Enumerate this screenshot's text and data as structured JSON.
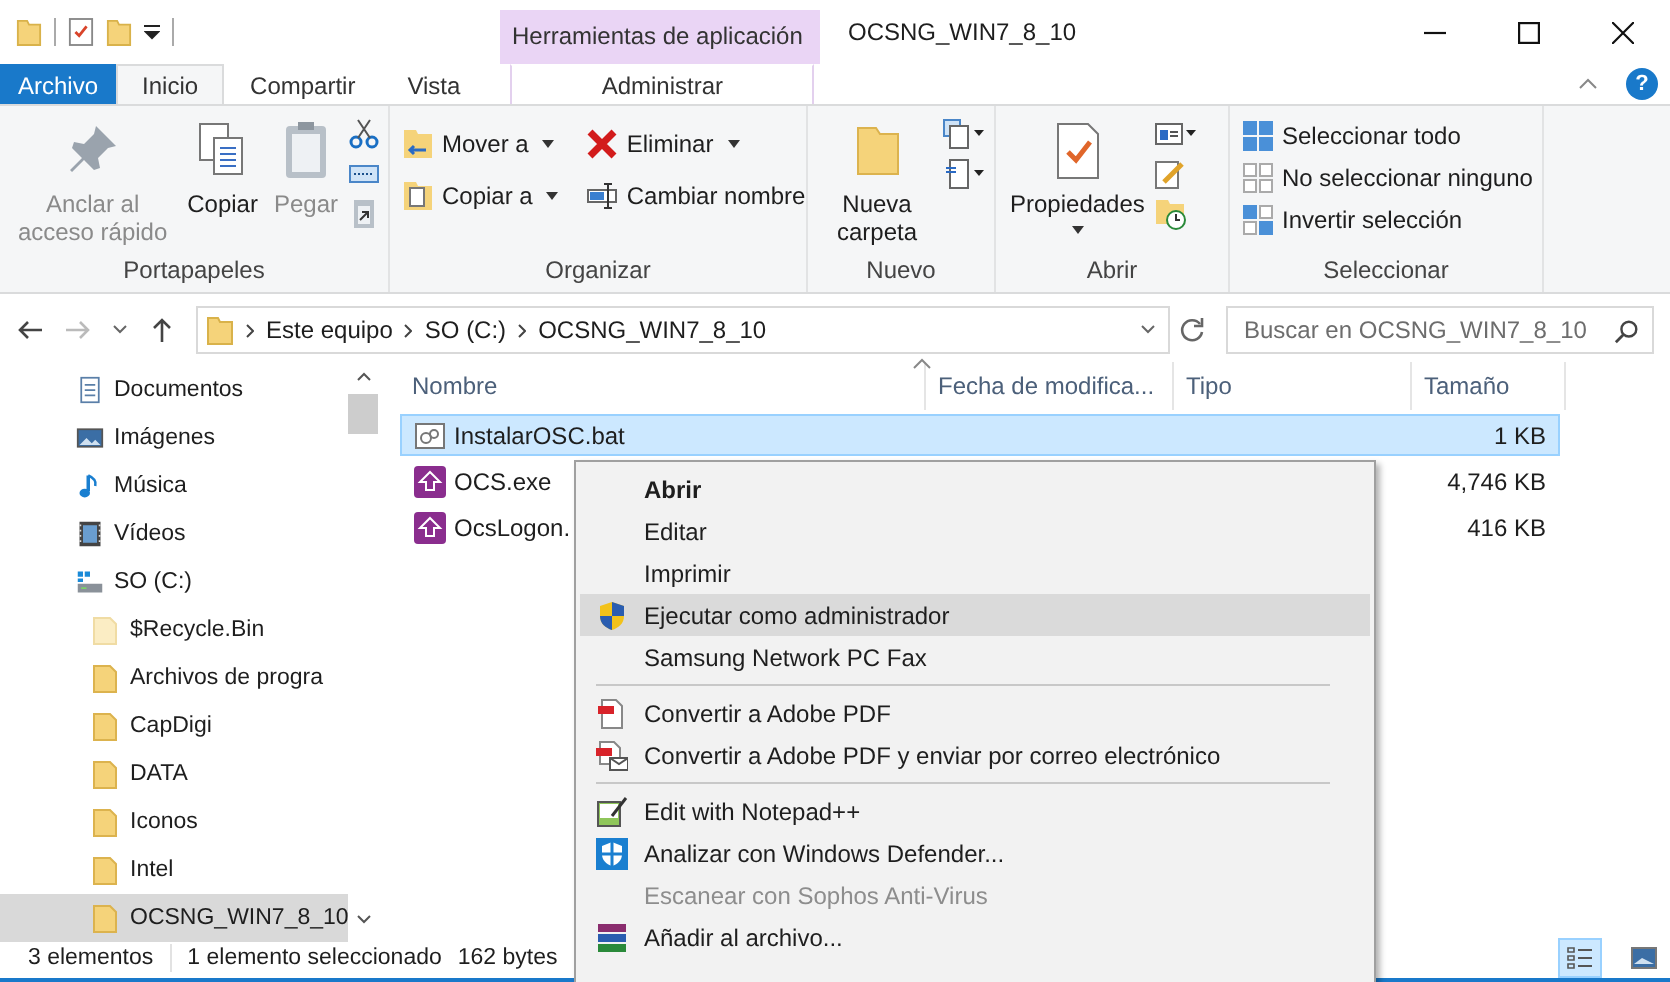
{
  "window": {
    "title": "OCSNG_WIN7_8_10",
    "context_header": "Herramientas de aplicación",
    "help_label": "?"
  },
  "tabs": [
    {
      "label": "Archivo",
      "kind": "file",
      "selected": false
    },
    {
      "label": "Inicio",
      "kind": "normal",
      "selected": true
    },
    {
      "label": "Compartir",
      "kind": "normal",
      "selected": false
    },
    {
      "label": "Vista",
      "kind": "normal",
      "selected": false
    },
    {
      "label": "Administrar",
      "kind": "context",
      "selected": false
    }
  ],
  "ribbon": {
    "clipboard": {
      "label": "Portapapeles",
      "pin": {
        "label": "Anclar al acceso rápido",
        "disabled": true
      },
      "copy": {
        "label": "Copiar",
        "disabled": false
      },
      "paste": {
        "label": "Pegar",
        "disabled": true
      }
    },
    "organize": {
      "label": "Organizar",
      "move": "Mover a",
      "copy_to": "Copiar a",
      "delete": "Eliminar",
      "rename": "Cambiar nombre"
    },
    "new": {
      "label": "Nuevo",
      "new_folder": "Nueva carpeta"
    },
    "open": {
      "label": "Abrir",
      "properties": "Propiedades"
    },
    "select": {
      "label": "Seleccionar",
      "items": [
        "Seleccionar todo",
        "No seleccionar ninguno",
        "Invertir selección"
      ]
    }
  },
  "address": {
    "breadcrumbs": [
      "Este equipo",
      "SO (C:)",
      "OCSNG_WIN7_8_10"
    ],
    "search_placeholder": "Buscar en OCSNG_WIN7_8_10"
  },
  "sidebar": {
    "items": [
      {
        "label": "Documentos",
        "selected": false
      },
      {
        "label": "Imágenes",
        "selected": false
      },
      {
        "label": "Música",
        "selected": false
      },
      {
        "label": "Vídeos",
        "selected": false
      },
      {
        "label": "SO (C:)",
        "selected": false,
        "children": [
          {
            "label": "$Recycle.Bin",
            "selected": false
          },
          {
            "label": "Archivos de progra",
            "selected": false
          },
          {
            "label": "CapDigi",
            "selected": false
          },
          {
            "label": "DATA",
            "selected": false
          },
          {
            "label": "Iconos",
            "selected": false
          },
          {
            "label": "Intel",
            "selected": false
          },
          {
            "label": "OCSNG_WIN7_8_10",
            "selected": true
          }
        ]
      }
    ]
  },
  "table": {
    "columns": [
      "Nombre",
      "Fecha de modifica...",
      "Tipo",
      "Tamaño"
    ],
    "rows": [
      {
        "name": "InstalarOSC.bat",
        "size": "1 KB",
        "selected": true
      },
      {
        "name": "OCS.exe",
        "size": "4,746 KB",
        "selected": false
      },
      {
        "name": "OcsLogon.",
        "size": "416 KB",
        "selected": false
      }
    ]
  },
  "context_menu": {
    "items": [
      {
        "kind": "item",
        "label": "Abrir",
        "default": true,
        "highlighted": false,
        "disabled": false
      },
      {
        "kind": "item",
        "label": "Editar",
        "default": false,
        "highlighted": false,
        "disabled": false
      },
      {
        "kind": "item",
        "label": "Imprimir",
        "default": false,
        "highlighted": false,
        "disabled": false
      },
      {
        "kind": "item",
        "label": "Ejecutar como administrador",
        "default": false,
        "highlighted": true,
        "disabled": false
      },
      {
        "kind": "item",
        "label": "Samsung Network PC Fax",
        "default": false,
        "highlighted": false,
        "disabled": false
      },
      {
        "kind": "separator"
      },
      {
        "kind": "item",
        "label": "Convertir a Adobe PDF",
        "default": false,
        "highlighted": false,
        "disabled": false
      },
      {
        "kind": "item",
        "label": "Convertir a Adobe PDF y enviar por correo electrónico",
        "default": false,
        "highlighted": false,
        "disabled": false
      },
      {
        "kind": "separator"
      },
      {
        "kind": "item",
        "label": "Edit with Notepad++",
        "default": false,
        "highlighted": false,
        "disabled": false
      },
      {
        "kind": "item",
        "label": "Analizar con Windows Defender...",
        "default": false,
        "highlighted": false,
        "disabled": false
      },
      {
        "kind": "item",
        "label": "Escanear con Sophos Anti-Virus",
        "default": false,
        "highlighted": false,
        "disabled": true
      },
      {
        "kind": "item",
        "label": "Añadir al archivo...",
        "default": false,
        "highlighted": false,
        "disabled": false
      }
    ]
  },
  "status_bar": {
    "count": "3 elementos",
    "selection": "1 elemento seleccionado",
    "size": "162 bytes",
    "views": [
      {
        "kind": "details",
        "selected": true
      },
      {
        "kind": "icons",
        "selected": false
      }
    ]
  }
}
